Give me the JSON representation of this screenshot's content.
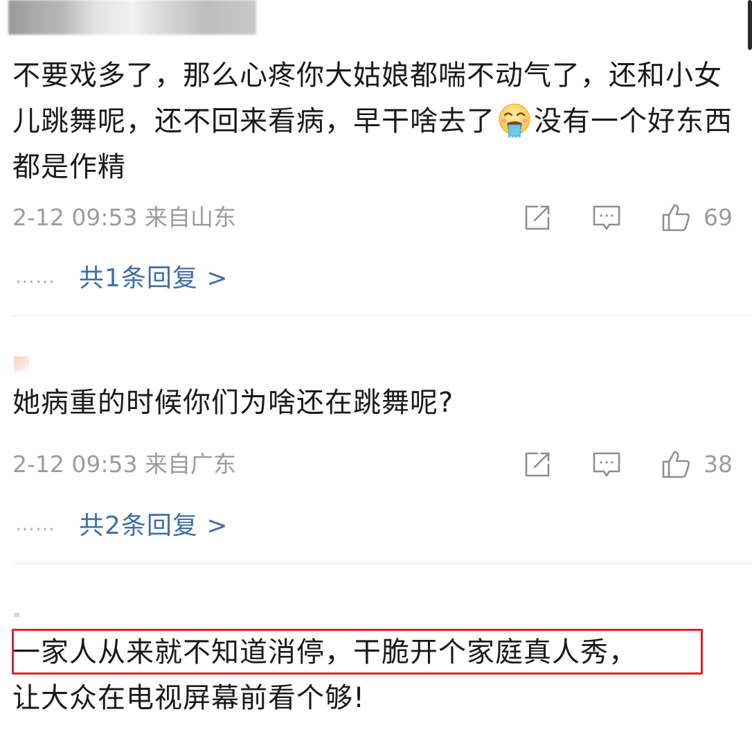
{
  "comments": [
    {
      "text_before_emoji": "不要戏多了，那么心疼你大姑娘都喘不动气了，还和小女儿跳舞呢，还不回来看病，早干啥去了",
      "emoji": "vomit-face-emoji",
      "text_after_emoji": "没有一个好东西都是作精",
      "time": "2-12 09:53",
      "location": "来自山东",
      "likes": "69",
      "replies": "共1条回复 >"
    },
    {
      "text": "她病重的时候你们为啥还在跳舞呢?",
      "time": "2-12 09:53",
      "location": "来自广东",
      "likes": "38",
      "replies": "共2条回复 >"
    },
    {
      "highlighted_line": "一家人从来就不知道消停，干脆开个家庭真人秀，",
      "rest": "让大众在电视屏幕前看个够!"
    }
  ],
  "reply_dots": "……",
  "icons": {
    "share": "share-icon",
    "comment": "comment-icon",
    "like": "thumbs-up-icon"
  },
  "colors": {
    "link": "#3f6ea8",
    "meta": "#9c9c9c",
    "highlight": "#e0212b"
  }
}
